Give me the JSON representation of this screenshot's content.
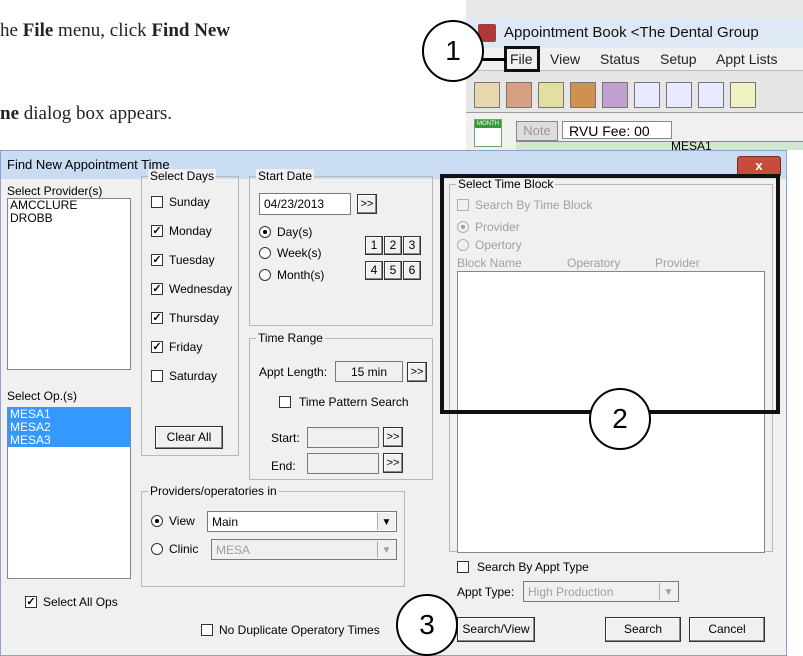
{
  "instructions": {
    "step_prefix": "he ",
    "menu_word": "File",
    "step_mid": " menu, click ",
    "command_word": "Find New",
    "result_bold": "ne",
    "result_rest": " dialog box appears."
  },
  "appt_book": {
    "title": "Appointment Book <The Dental Group",
    "menu": [
      "File",
      "View",
      "Status",
      "Setup",
      "Appt Lists"
    ],
    "month_label": "MONTH",
    "note": "Note",
    "rvu": "RVU Fee: 00",
    "mesa": "MESA1"
  },
  "dialog": {
    "title": "Find New Appointment Time",
    "close_label": "x",
    "providers_label": "Select Provider(s)",
    "providers": [
      "AMCCLURE",
      "DROBB"
    ],
    "ops_label": "Select Op.(s)",
    "ops": [
      "MESA1",
      "MESA2",
      "MESA3"
    ],
    "select_all_ops": "Select All Ops",
    "select_days": {
      "title": "Select Days",
      "days": [
        {
          "label": "Sunday",
          "checked": false
        },
        {
          "label": "Monday",
          "checked": true
        },
        {
          "label": "Tuesday",
          "checked": true
        },
        {
          "label": "Wednesday",
          "checked": true
        },
        {
          "label": "Thursday",
          "checked": true
        },
        {
          "label": "Friday",
          "checked": true
        },
        {
          "label": "Saturday",
          "checked": false
        }
      ],
      "clear_all": "Clear All"
    },
    "start_date": {
      "title": "Start Date",
      "value": "04/23/2013",
      "next": ">>",
      "units": [
        "Day(s)",
        "Week(s)",
        "Month(s)"
      ],
      "numbers": [
        "1",
        "2",
        "3",
        "4",
        "5",
        "6"
      ]
    },
    "time_range": {
      "title": "Time Range",
      "appt_length_label": "Appt Length:",
      "appt_length": "15 min",
      "next": ">>",
      "time_pattern": "Time Pattern Search",
      "start_label": "Start:",
      "end_label": "End:"
    },
    "providers_ops": {
      "title": "Providers/operatories in",
      "view_label": "View",
      "view_value": "Main",
      "clinic_label": "Clinic",
      "clinic_value": "MESA"
    },
    "time_block": {
      "title": "Select Time Block",
      "search_by_block": "Search By Time Block",
      "provider": "Provider",
      "opertory": "Opertory",
      "columns": [
        "Block Name",
        "Operatory",
        "Provider"
      ]
    },
    "search_by_appt_type": "Search By Appt Type",
    "appt_type_label": "Appt Type:",
    "appt_type_value": "High Production",
    "no_duplicate": "No Duplicate Operatory Times",
    "buttons": {
      "search_view": "Search/View",
      "search": "Search",
      "cancel": "Cancel"
    }
  },
  "callouts": [
    "1",
    "2",
    "3"
  ]
}
